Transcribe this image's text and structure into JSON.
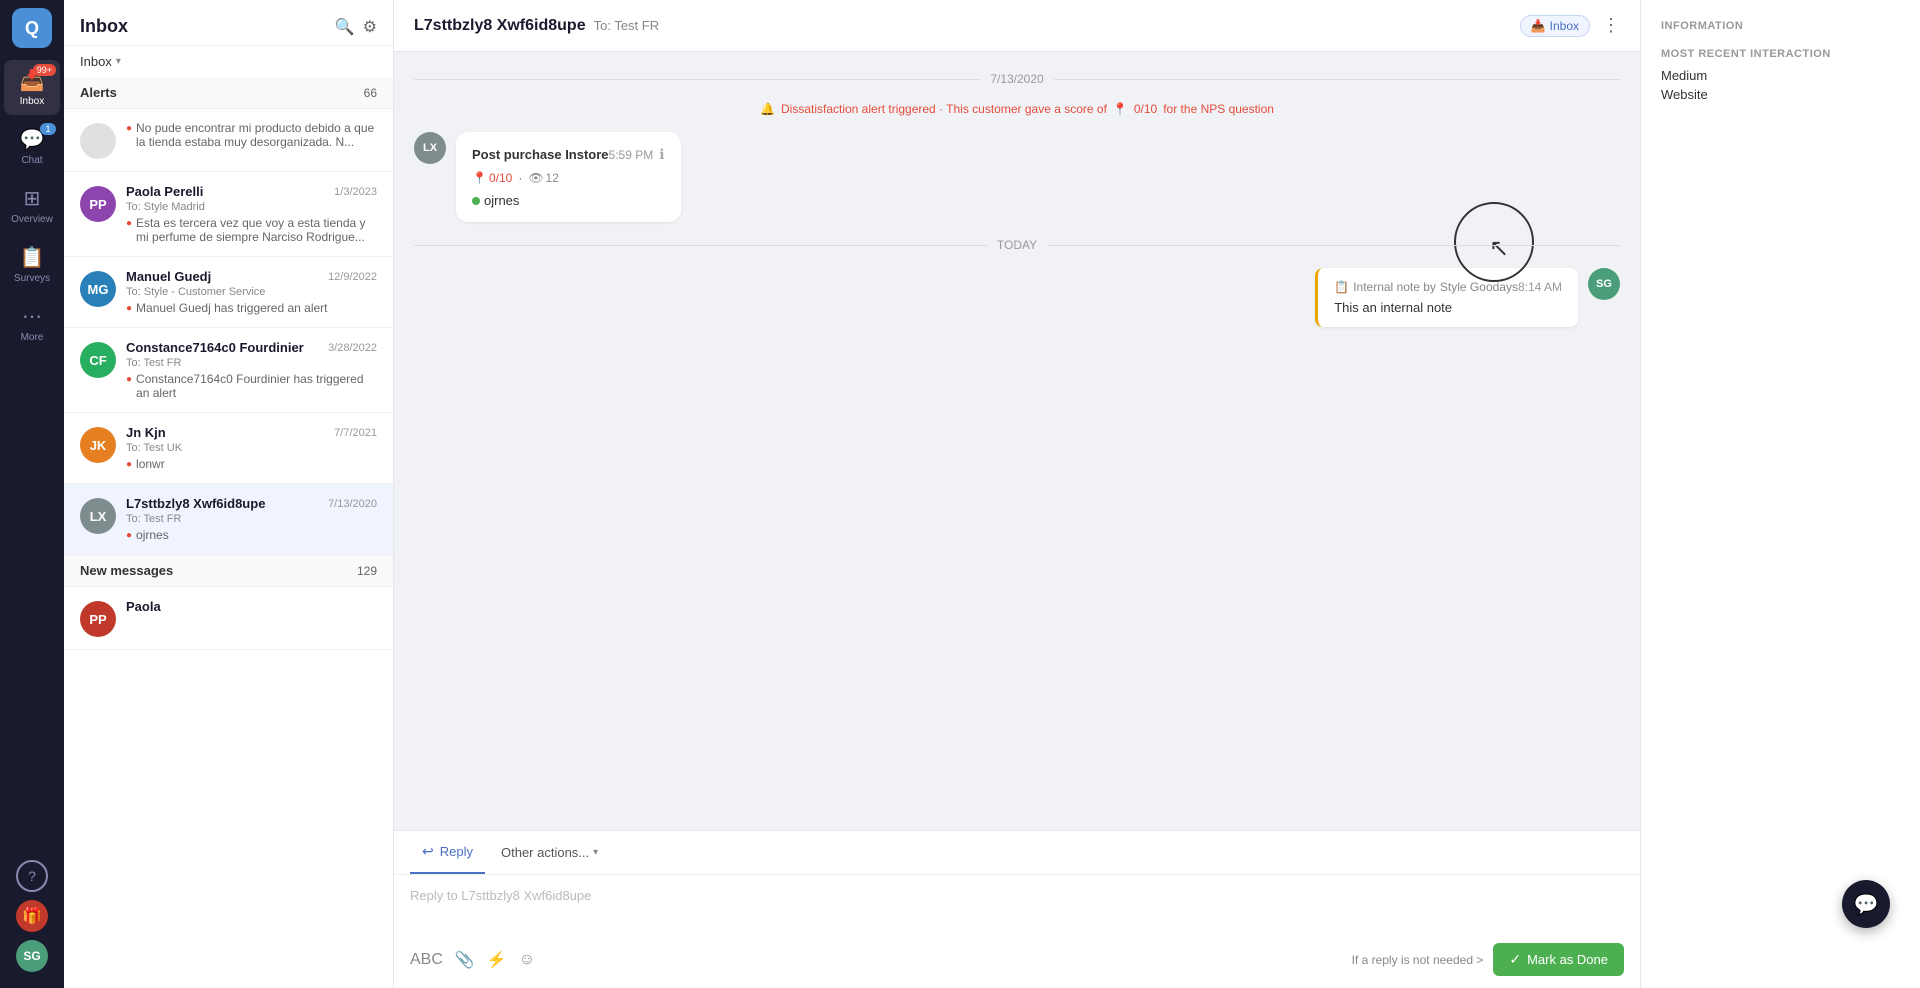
{
  "app": {
    "logo": "Q",
    "logo_bg": "#4a90d9"
  },
  "nav": {
    "items": [
      {
        "id": "inbox",
        "icon": "📥",
        "label": "Inbox",
        "active": true,
        "badge": "99+",
        "badge_color": "red"
      },
      {
        "id": "chat",
        "icon": "💬",
        "label": "Chat",
        "active": false,
        "badge": "1",
        "badge_color": "blue"
      },
      {
        "id": "overview",
        "icon": "⊞",
        "label": "Overview",
        "active": false
      },
      {
        "id": "surveys",
        "icon": "📋",
        "label": "Surveys",
        "active": false
      },
      {
        "id": "more",
        "icon": "⋯",
        "label": "More",
        "active": false
      }
    ],
    "help_icon": "?",
    "gift_icon": "🎁",
    "bottom_avatar_initials": "SG",
    "bottom_avatar_bg": "#4a9e7a"
  },
  "inbox": {
    "title": "Inbox",
    "tab_label": "Inbox",
    "tab_chevron": "▾",
    "search_icon": "🔍",
    "filter_icon": "⚙",
    "alerts_label": "Alerts",
    "alerts_count": "66",
    "new_messages_label": "New messages",
    "new_messages_count": "129",
    "items": [
      {
        "id": "alert-prev",
        "initials": "",
        "bg": "#e0e0e0",
        "name": "",
        "date": "",
        "to": "",
        "preview": "No pude encontrar mi producto debido a que la tienda estaba muy desorganizada. N...",
        "has_alert": true,
        "is_truncated": true
      },
      {
        "id": "paola-perelli",
        "initials": "PP",
        "bg": "#8e44ad",
        "name": "Paola Perelli",
        "date": "1/3/2023",
        "to": "To: Style Madrid",
        "preview": "Esta es tercera vez que voy a esta tienda y mi perfume de siempre Narciso Rodrigue...",
        "has_alert": true
      },
      {
        "id": "manuel-guedj",
        "initials": "MG",
        "bg": "#2980b9",
        "name": "Manuel Guedj",
        "date": "12/9/2022",
        "to": "To: Style - Customer Service",
        "preview": "Manuel Guedj has triggered an alert",
        "has_alert": true
      },
      {
        "id": "constance",
        "initials": "CF",
        "bg": "#27ae60",
        "name": "Constance7164c0 Fourdinier",
        "date": "3/28/2022",
        "to": "To: Test FR",
        "preview": "Constance7164c0 Fourdinier has triggered an alert",
        "has_alert": true
      },
      {
        "id": "jn-kjn",
        "initials": "JK",
        "bg": "#e67e22",
        "name": "Jn Kjn",
        "date": "7/7/2021",
        "to": "To: Test UK",
        "preview": "lonwr",
        "has_alert": true
      },
      {
        "id": "l7sttbzly8",
        "initials": "LX",
        "bg": "#7f8c8d",
        "name": "L7sttbzly8 Xwf6id8upe",
        "date": "7/13/2020",
        "to": "To: Test FR",
        "preview": "ojrnes",
        "has_alert": true,
        "active": true
      }
    ],
    "new_messages_items": [
      {
        "id": "paola-new",
        "initials": "PP",
        "bg": "#c0392b",
        "name": "Paola",
        "date": "",
        "to": "",
        "preview": ""
      }
    ]
  },
  "conversation": {
    "title": "L7sttbzly8 Xwf6id8upe",
    "to": "To: Test FR",
    "inbox_badge": "Inbox",
    "more_icon": "⋮",
    "date_7_13": "7/13/2020",
    "date_today": "TODAY",
    "alert_message": "Dissatisfaction alert triggered · This customer gave a score of",
    "alert_score_icon": "📍",
    "alert_score": "0/10",
    "alert_nps": "for the NPS question",
    "message": {
      "avatar_initials": "LX",
      "avatar_bg": "#7f8c8d",
      "type": "Post purchase Instore",
      "time": "5:59 PM",
      "nps_score": "0/10",
      "views": "12",
      "response": "ojrnes",
      "response_dot_color": "#4caf50"
    },
    "internal_note": {
      "avatar_initials": "SG",
      "avatar_bg": "#4a9e7a",
      "label": "Internal note by",
      "author": "Style Goodays",
      "time": "8:14 AM",
      "text": "This an internal note"
    }
  },
  "reply": {
    "tab_reply": "Reply",
    "tab_reply_icon": "↩",
    "other_actions": "Other actions...",
    "other_actions_chevron": "▾",
    "placeholder": "Reply to L7sttbzly8 Xwf6id8upe",
    "toolbar_icons": [
      "A",
      "📎",
      "⚡",
      "☺"
    ],
    "no_reply_text": "If a reply is not needed >",
    "mark_done_label": "Mark as Done",
    "mark_done_check": "✓"
  },
  "info_panel": {
    "section_title": "INFORMATION",
    "subsection_title": "MOST RECENT INTERACTION",
    "medium_label": "Medium",
    "medium_value": "Website"
  },
  "colors": {
    "accent_blue": "#4a70c4",
    "alert_red": "#e74c3c",
    "green": "#4caf50",
    "gold": "#f0a500"
  }
}
